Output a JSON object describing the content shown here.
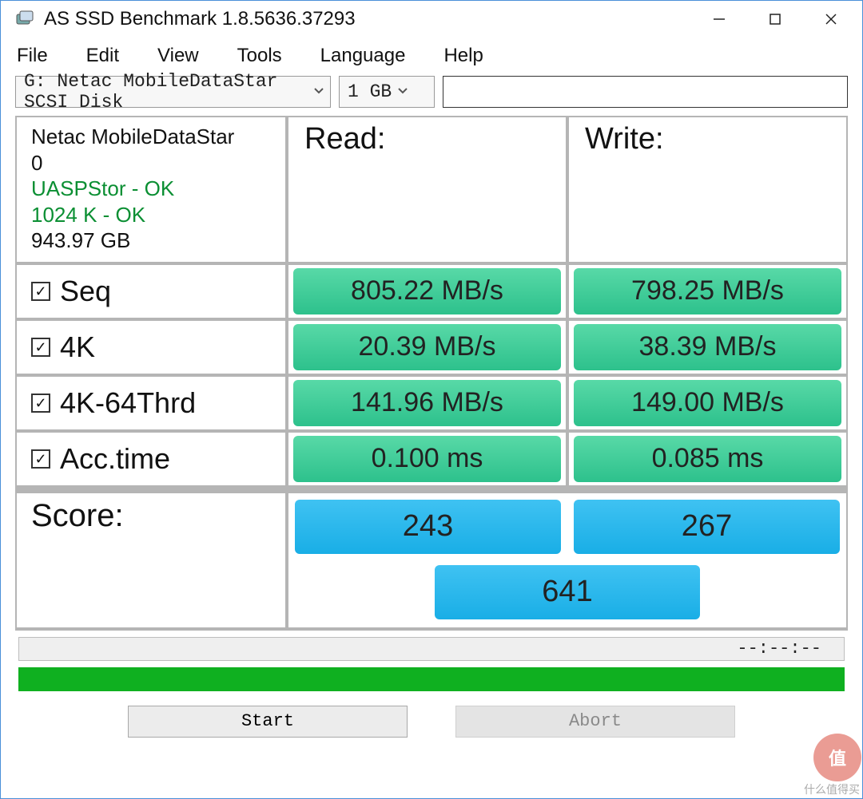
{
  "window": {
    "title": "AS SSD Benchmark 1.8.5636.37293"
  },
  "menu": {
    "file": "File",
    "edit": "Edit",
    "view": "View",
    "tools": "Tools",
    "language": "Language",
    "help": "Help"
  },
  "toolbar": {
    "drive": "G: Netac MobileDataStar SCSI Disk",
    "size": "1 GB",
    "search": ""
  },
  "drive_info": {
    "name": "Netac MobileDataStar",
    "number": "0",
    "controller_status": "UASPStor - OK",
    "alignment_status": "1024 K - OK",
    "capacity": "943.97 GB"
  },
  "headers": {
    "read": "Read:",
    "write": "Write:",
    "score": "Score:"
  },
  "rows": {
    "seq": {
      "label": "Seq",
      "checked": true,
      "read": "805.22 MB/s",
      "write": "798.25 MB/s"
    },
    "fourk": {
      "label": "4K",
      "checked": true,
      "read": "20.39 MB/s",
      "write": "38.39 MB/s"
    },
    "fourk64": {
      "label": "4K-64Thrd",
      "checked": true,
      "read": "141.96 MB/s",
      "write": "149.00 MB/s"
    },
    "acc": {
      "label": "Acc.time",
      "checked": true,
      "read": "0.100 ms",
      "write": "0.085 ms"
    }
  },
  "scores": {
    "read": "243",
    "write": "267",
    "total": "641"
  },
  "status": {
    "text": "--:--:--"
  },
  "buttons": {
    "start": "Start",
    "abort": "Abort"
  },
  "watermark": {
    "badge": "值",
    "text": "什么值得买"
  }
}
